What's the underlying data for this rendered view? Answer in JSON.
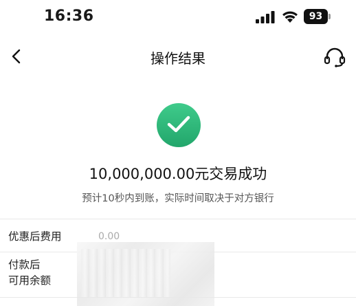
{
  "status_bar": {
    "time": "16:36",
    "battery_level": "93",
    "icons": [
      "cellular-signal-icon",
      "wifi-icon",
      "battery-icon"
    ]
  },
  "nav": {
    "title": "操作结果",
    "back_icon": "chevron-left-icon",
    "support_icon": "headset-icon"
  },
  "result": {
    "icon": "check-circle-icon",
    "title": "10,000,000.00元交易成功",
    "subtitle": "预计10秒内到账，实际时间取决于对方银行",
    "accent_color": "#2dbb7a"
  },
  "details": {
    "fee_label": "优惠后费用",
    "fee_value": "0.00",
    "balance_label_line1": "付款后",
    "balance_label_line2": "可用余额"
  }
}
